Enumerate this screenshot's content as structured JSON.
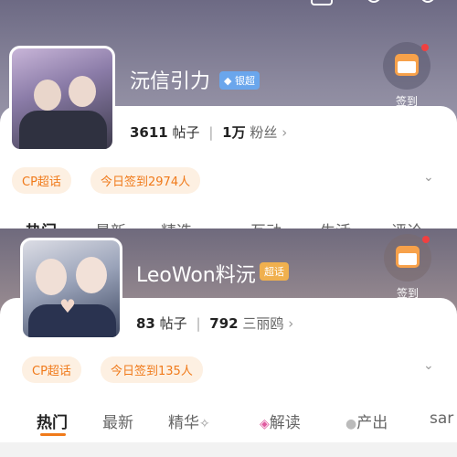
{
  "top_panel": {
    "title": "沅信引力",
    "badge": "银超",
    "posts_count": "3611",
    "posts_label": "帖子",
    "fans_count": "1万",
    "fans_label": "粉丝",
    "signin_label": "签到",
    "chip_cp": "CP超话",
    "chip_checkin": "今日签到2974人",
    "tabs": [
      "热门",
      "最新",
      "精选",
      "互动",
      "生活",
      "评论"
    ]
  },
  "bottom_panel": {
    "title": "LeoWon料沅",
    "badge": "超话",
    "posts_count": "83",
    "posts_label": "帖子",
    "fans_count": "792",
    "fans_label": "三丽鸥",
    "signin_label": "签到",
    "chip_cp": "CP超话",
    "chip_checkin": "今日签到135人",
    "tabs": [
      "热门",
      "最新",
      "精华",
      "解读",
      "产出",
      "sar"
    ]
  },
  "colors": {
    "accent_orange": "#f07a1a",
    "chip_bg": "#fdf0e2",
    "badge_silver": "#6aa6ec",
    "badge_gold": "#f0b04e"
  }
}
